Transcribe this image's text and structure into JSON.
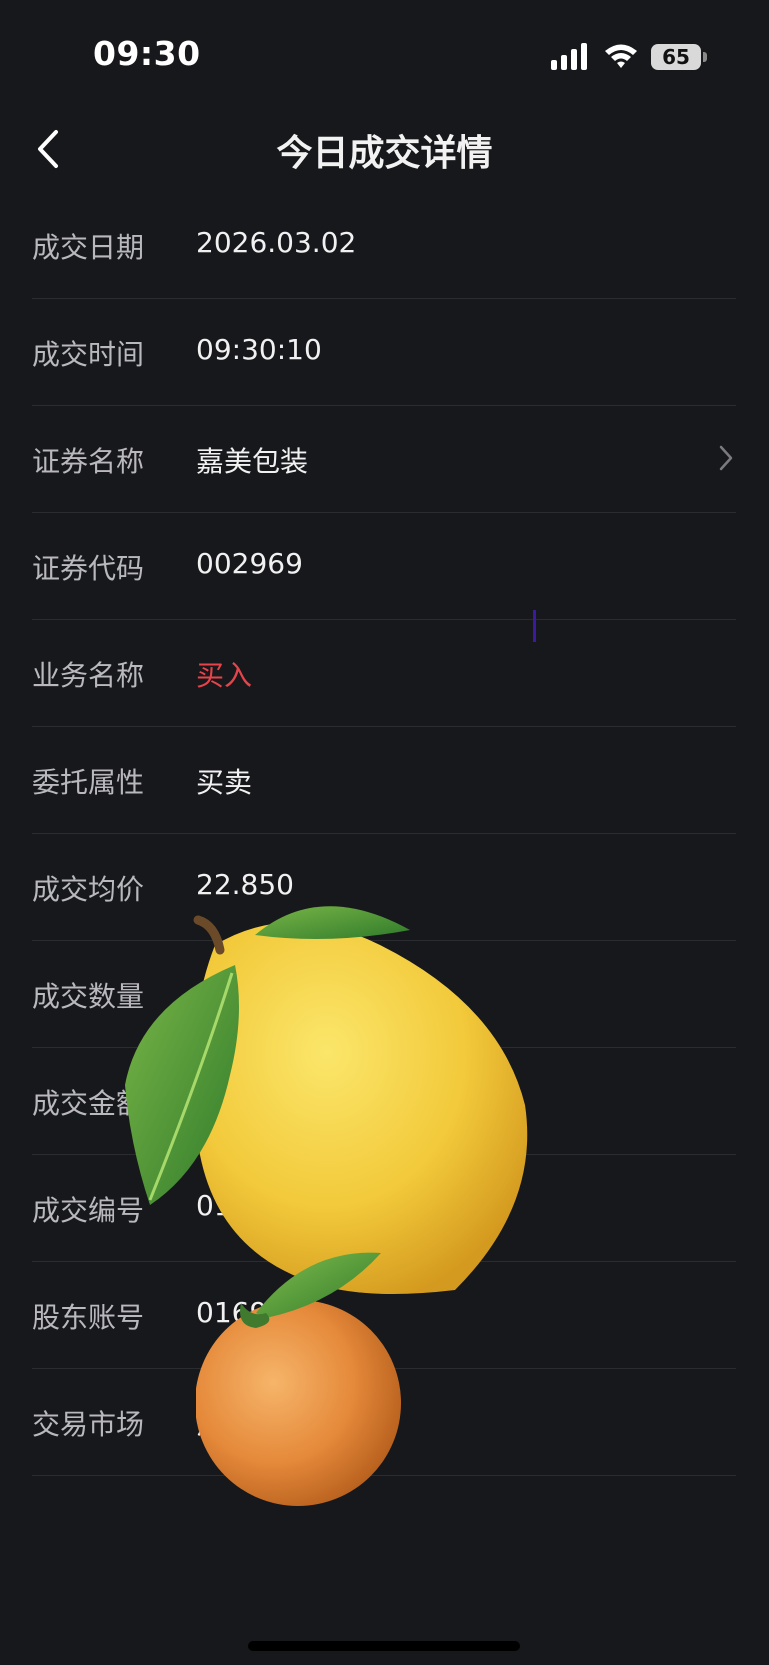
{
  "status_bar": {
    "time": "09:30",
    "battery": "65",
    "icons": [
      "signal-icon",
      "wifi-icon",
      "battery-icon"
    ]
  },
  "nav": {
    "title": "今日成交详情",
    "back_icon": "chevron-left-icon"
  },
  "rows": [
    {
      "label": "成交日期",
      "value": "2026.03.02"
    },
    {
      "label": "成交时间",
      "value": "09:30:10"
    },
    {
      "label": "证券名称",
      "value": "嘉美包装",
      "chevron": true
    },
    {
      "label": "证券代码",
      "value": "002969"
    },
    {
      "label": "业务名称",
      "value": "买入",
      "color": "#e8434a"
    },
    {
      "label": "委托属性",
      "value": "买卖"
    },
    {
      "label": "成交均价",
      "value": "22.850"
    },
    {
      "label": "成交数量",
      "value": ""
    },
    {
      "label": "成交金额",
      "value": ""
    },
    {
      "label": "成交编号",
      "value": "01"
    },
    {
      "label": "股东账号",
      "value": "0169"
    },
    {
      "label": "交易市场",
      "value": "深"
    }
  ],
  "colors": {
    "background": "#17181b",
    "accent_red": "#e8434a"
  },
  "overlay_images": [
    "lemon-emoji",
    "orange-emoji"
  ]
}
